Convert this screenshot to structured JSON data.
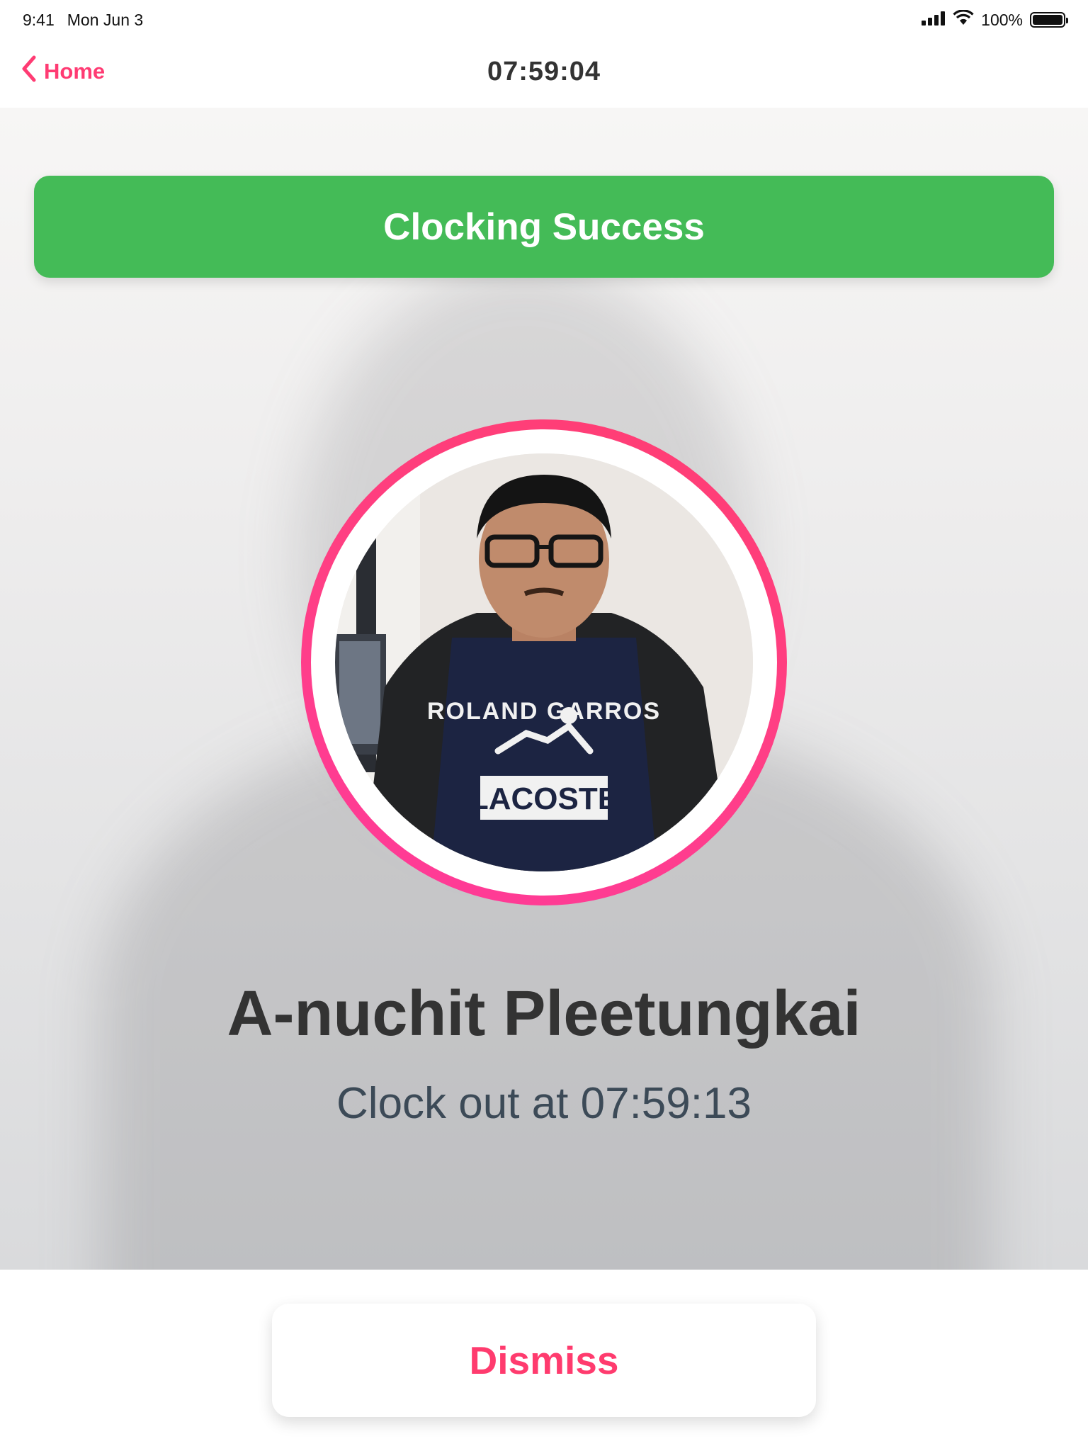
{
  "status_bar": {
    "time": "9:41",
    "date": "Mon Jun 3",
    "battery": "100%",
    "icons": [
      "signal-icon",
      "wifi-icon",
      "battery-icon"
    ]
  },
  "nav": {
    "back_label": "Home",
    "title": "07:59:04"
  },
  "banner": {
    "text": "Clocking Success",
    "color": "#44bb57"
  },
  "avatar": {
    "ring_color": "#ff3d7a",
    "shirt_text_top": "ROLAND GARROS",
    "shirt_text_bottom": "LACOSTE"
  },
  "person": {
    "name": "A-nuchit Pleetungkai",
    "clock_text": "Clock out at 07:59:13"
  },
  "dismiss": {
    "label": "Dismiss",
    "color": "#ff3b6e"
  }
}
